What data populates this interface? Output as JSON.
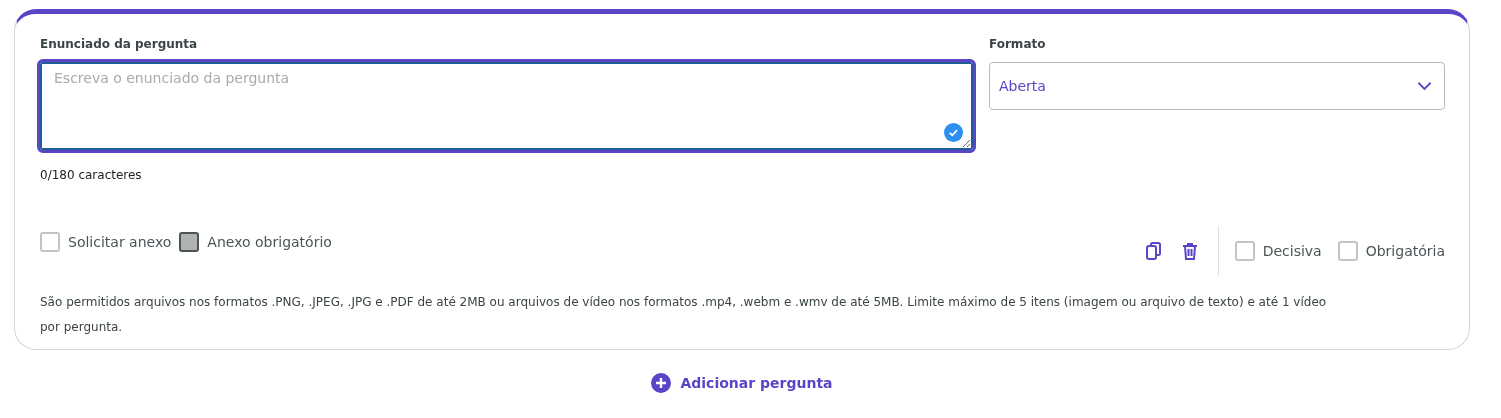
{
  "question": {
    "label": "Enunciado da pergunta",
    "placeholder": "Escreva o enunciado da pergunta",
    "counter": "0/180 caracteres",
    "focused": true,
    "valid": true
  },
  "format": {
    "label": "Formato",
    "value": "Aberta"
  },
  "attachment_options": [
    {
      "label": "Solicitar anexo",
      "checked": false,
      "disabled": false
    },
    {
      "label": "Anexo obrigatório",
      "checked": false,
      "disabled": true
    }
  ],
  "question_options": [
    {
      "label": "Decisiva",
      "checked": false
    },
    {
      "label": "Obrigatória",
      "checked": false
    }
  ],
  "help_text": "São permitidos arquivos nos formatos .PNG, .JPEG, .JPG e .PDF de até 2MB ou arquivos de vídeo nos formatos .mp4, .webm e .wmv de até 5MB. Limite máximo de 5 itens (imagem ou arquivo de texto) e até 1 vídeo por pergunta.",
  "add_button": "Adicionar pergunta"
}
